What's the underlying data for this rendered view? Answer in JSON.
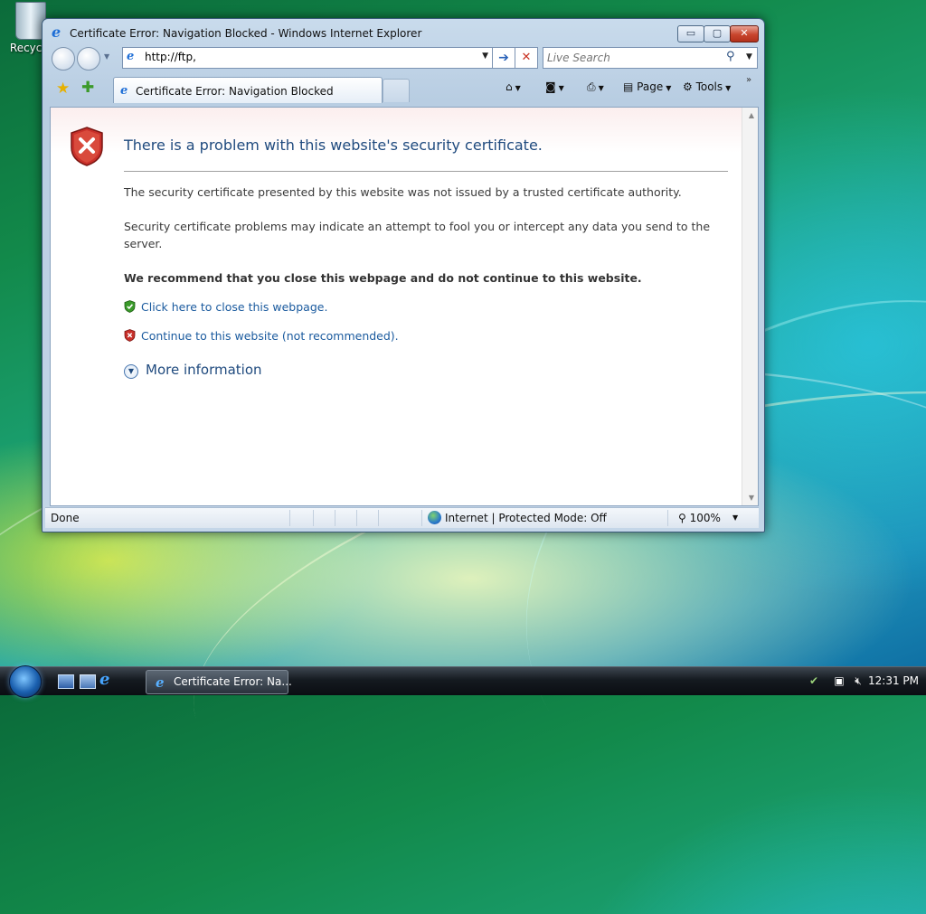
{
  "desktop": {
    "recycle_bin_label": "Recycle"
  },
  "window": {
    "title": "Certificate Error: Navigation Blocked - Windows Internet Explorer",
    "controls": {
      "minimize": "▭",
      "maximize": "▢",
      "close": "✕"
    }
  },
  "navbar": {
    "address_value": "http://ftp,",
    "search_placeholder": "Live Search"
  },
  "tabs": [
    {
      "label": "Certificate Error: Navigation Blocked",
      "active": true
    }
  ],
  "command_bar": {
    "page_label": "Page",
    "tools_label": "Tools"
  },
  "content": {
    "title": "There is a problem with this website's security certificate.",
    "paragraph1": "The security certificate presented by this website was not issued by a trusted certificate authority.",
    "paragraph2": "Security certificate problems may indicate an attempt to fool you or intercept any data you send to the server.",
    "recommendation": "We recommend that you close this webpage and do not continue to this website.",
    "close_link": "Click here to close this webpage.",
    "continue_link": "Continue to this website (not recommended).",
    "more_info": "More information"
  },
  "statusbar": {
    "status": "Done",
    "zone": "Internet | Protected Mode: Off",
    "zoom": "100%"
  },
  "taskbar": {
    "task_label": "Certificate Error: Na...",
    "clock": "12:31 PM"
  },
  "colors": {
    "link": "#1a5a9e",
    "title_blue": "#1f4a7e",
    "error_red": "#c8302a",
    "safe_green": "#3a9a2a"
  }
}
